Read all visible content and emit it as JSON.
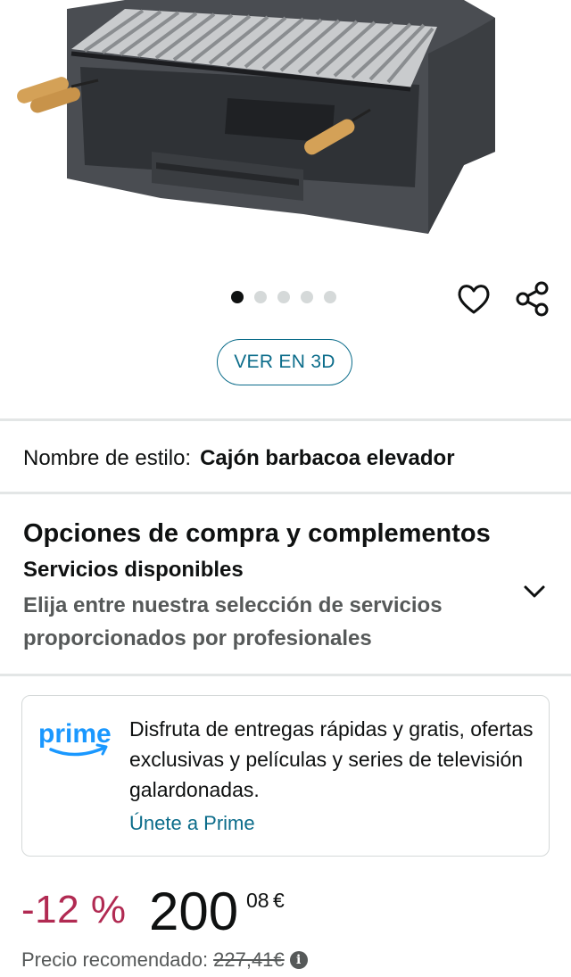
{
  "carousel": {
    "page_count": 5,
    "active_index": 0
  },
  "icons": {
    "wishlist": "heart-icon",
    "share": "share-icon",
    "expand": "chevron-down-icon",
    "info": "info-icon"
  },
  "view_3d_label": "VER EN 3D",
  "style": {
    "label": "Nombre de estilo:",
    "value": "Cajón barbacoa elevador"
  },
  "purchase_options": {
    "title": "Opciones de compra y complementos",
    "subtitle": "Servicios disponibles",
    "description": "Elija entre nuestra selección de servicios proporcionados por profesionales"
  },
  "prime": {
    "logo_text": "prime",
    "text": "Disfruta de entregas rápidas y gratis, ofertas exclusivas y películas y series de televisión galardonadas.",
    "link": "Únete a Prime"
  },
  "price": {
    "discount": "-12 %",
    "whole": "200",
    "fraction": "08",
    "currency": "€",
    "recommended_label": "Precio recomendado:",
    "recommended_value": "227,41€"
  },
  "colors": {
    "link": "#0b6c8a",
    "discount": "#b12a52",
    "prime": "#1a98ff"
  }
}
